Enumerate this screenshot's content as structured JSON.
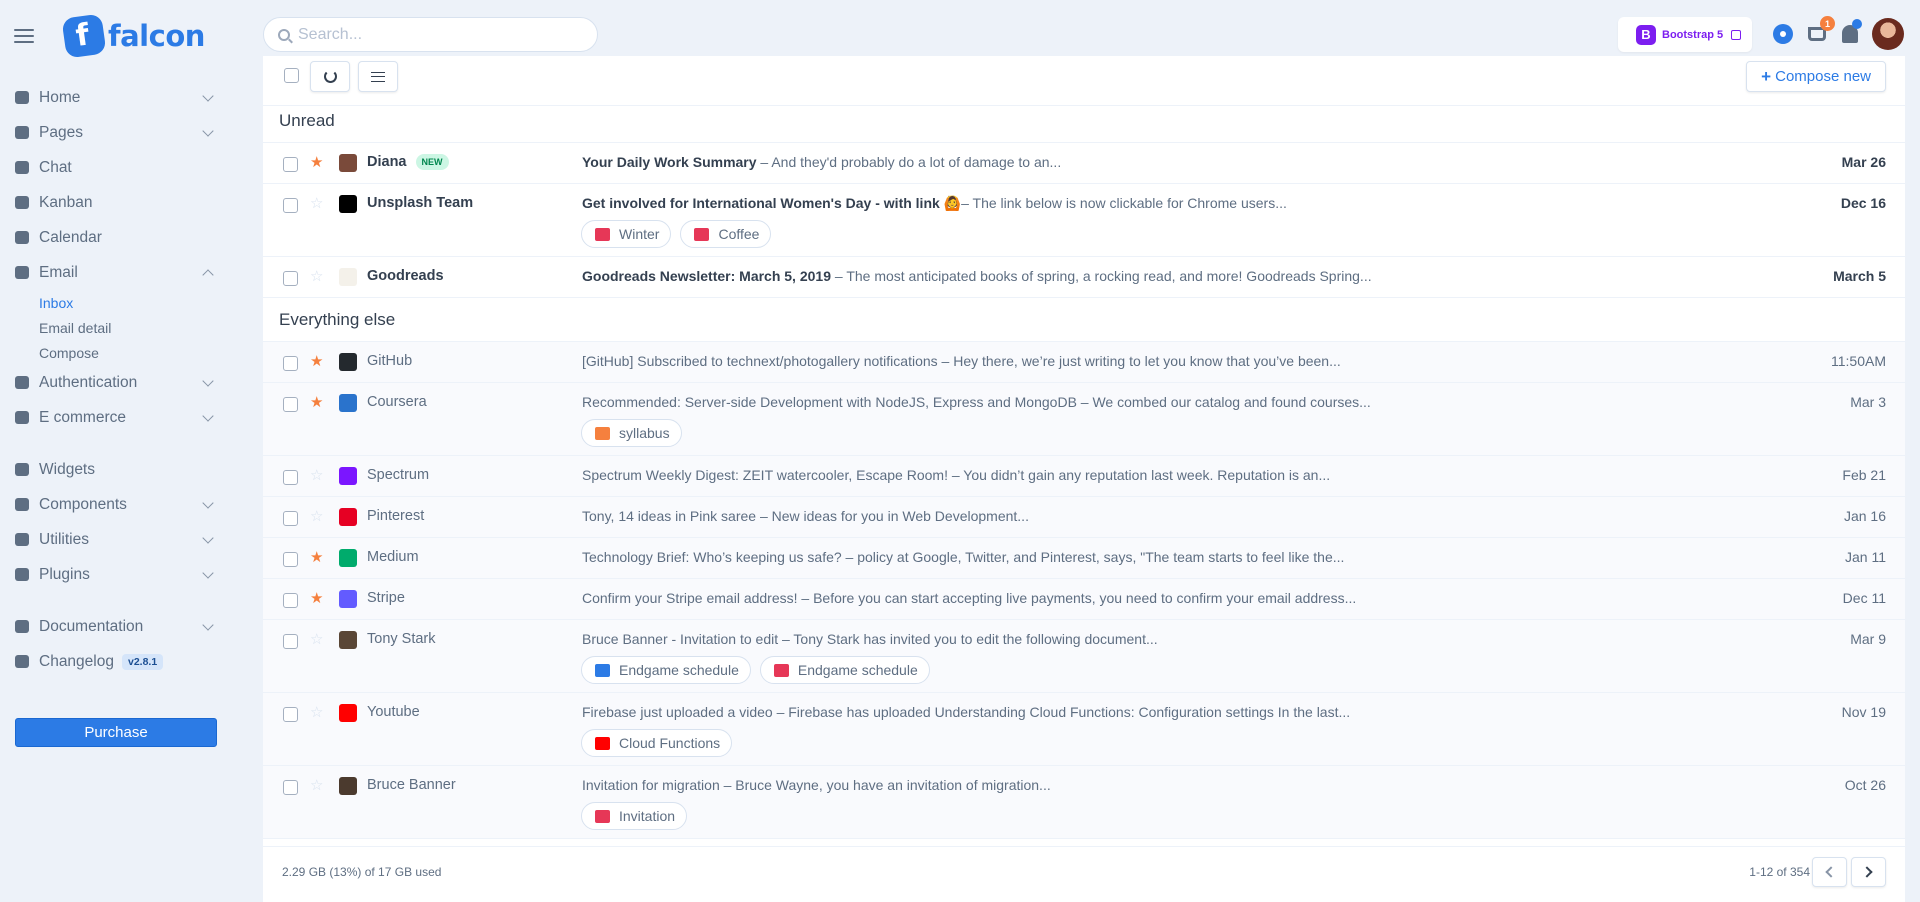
{
  "brand": {
    "name": "falcon"
  },
  "search": {
    "placeholder": "Search..."
  },
  "topbar": {
    "bootstrap_label": "Bootstrap 5",
    "cart_count": "1"
  },
  "sidebar": {
    "items": [
      {
        "label": "Home",
        "icon": "pie-chart-icon",
        "expandable": true
      },
      {
        "label": "Pages",
        "icon": "copy-icon",
        "expandable": true
      },
      {
        "label": "Chat",
        "icon": "comments-icon",
        "expandable": false
      },
      {
        "label": "Kanban",
        "icon": "trello-icon",
        "expandable": false
      },
      {
        "label": "Calendar",
        "icon": "calendar-icon",
        "expandable": false
      },
      {
        "label": "Email",
        "icon": "envelope-icon",
        "expandable": true,
        "open": true
      },
      {
        "label": "Authentication",
        "icon": "unlock-icon",
        "expandable": true
      },
      {
        "label": "E commerce",
        "icon": "cart-icon",
        "expandable": true
      },
      {
        "label": "Widgets",
        "icon": "poll-icon",
        "expandable": false
      },
      {
        "label": "Components",
        "icon": "puzzle-icon",
        "expandable": true
      },
      {
        "label": "Utilities",
        "icon": "fire-icon",
        "expandable": true
      },
      {
        "label": "Plugins",
        "icon": "plug-icon",
        "expandable": true
      },
      {
        "label": "Documentation",
        "icon": "book-icon",
        "expandable": true
      },
      {
        "label": "Changelog",
        "icon": "code-branch-icon",
        "expandable": false,
        "badge": "v2.8.1"
      }
    ],
    "email_sub": [
      "Inbox",
      "Email detail",
      "Compose"
    ],
    "purchase_label": "Purchase"
  },
  "toolbar": {
    "compose_label": "Compose new"
  },
  "sections": {
    "unread": "Unread",
    "everything_else": "Everything else"
  },
  "unread": [
    {
      "sender": "Diana",
      "badge": "NEW",
      "starred": true,
      "subject": "Your Daily Work Summary",
      "snippet": " – And they'd probably do a lot of damage to an...",
      "date": "Mar 26",
      "attachments": []
    },
    {
      "sender": "Unsplash Team",
      "starred": false,
      "subject": "Get involved for International Women's Day - with link 🙆",
      "snippet": "– The link below is now clickable for Chrome users...",
      "date": "Dec 16",
      "attachments": [
        {
          "label": "Winter",
          "type": "image"
        },
        {
          "label": "Coffee",
          "type": "image"
        }
      ]
    },
    {
      "sender": "Goodreads",
      "starred": false,
      "subject": "Goodreads Newsletter: March 5, 2019",
      "snippet": " – The most anticipated books of spring, a rocking read, and more! Goodreads Spring...",
      "date": "March 5",
      "attachments": []
    }
  ],
  "others": [
    {
      "sender": "GitHub",
      "starred": true,
      "subject": "[GitHub] Subscribed to technext/photogallery notifications",
      "snippet": " – Hey there, we’re just writing to let you know that you’ve been...",
      "date": "11:50AM",
      "attachments": []
    },
    {
      "sender": "Coursera",
      "starred": true,
      "subject": "Recommended: Server-side Development with NodeJS, Express and MongoDB",
      "snippet": " – We combed our catalog and found courses...",
      "date": "Mar 3",
      "attachments": [
        {
          "label": "syllabus",
          "type": "file"
        }
      ]
    },
    {
      "sender": "Spectrum",
      "starred": false,
      "subject": "Spectrum Weekly Digest: ZEIT watercooler, Escape Room!",
      "snippet": " – You didn’t gain any reputation last week. Reputation is an...",
      "date": "Feb 21",
      "attachments": []
    },
    {
      "sender": "Pinterest",
      "starred": false,
      "subject": "Tony, 14 ideas in Pink saree",
      "snippet": " – New ideas for you in Web Development...",
      "date": "Jan 16",
      "attachments": []
    },
    {
      "sender": "Medium",
      "starred": true,
      "subject": "Technology Brief: Who’s keeping us safe?",
      "snippet": " – policy at Google, Twitter, and Pinterest, says, \"The team starts to feel like the...",
      "date": "Jan 11",
      "attachments": []
    },
    {
      "sender": "Stripe",
      "starred": true,
      "subject": "Confirm your Stripe email address!",
      "snippet": " – Before you can start accepting live payments, you need to confirm your email address...",
      "date": "Dec 11",
      "attachments": []
    },
    {
      "sender": "Tony Stark",
      "starred": false,
      "subject": "Bruce Banner - Invitation to edit",
      "snippet": " – Tony Stark has invited you to edit the following document...",
      "date": "Mar 9",
      "attachments": [
        {
          "label": "Endgame schedule",
          "type": "doc"
        },
        {
          "label": "Endgame schedule",
          "type": "pdf"
        }
      ]
    },
    {
      "sender": "Youtube",
      "starred": false,
      "subject": "Firebase just uploaded a video",
      "snippet": " – Firebase has uploaded Understanding Cloud Functions: Configuration settings In the last...",
      "date": "Nov 19",
      "attachments": [
        {
          "label": "Cloud Functions",
          "type": "youtube"
        }
      ]
    },
    {
      "sender": "Bruce Banner",
      "starred": false,
      "subject": "Invitation for migration",
      "snippet": " – Bruce Wayne, you have an invitation of migration...",
      "date": "Oct 26",
      "attachments": [
        {
          "label": "Invitation",
          "type": "pdf"
        }
      ]
    }
  ],
  "footer": {
    "storage": "2.29 GB (13%) of 17 GB used",
    "page_info": "1-12 of 354"
  }
}
